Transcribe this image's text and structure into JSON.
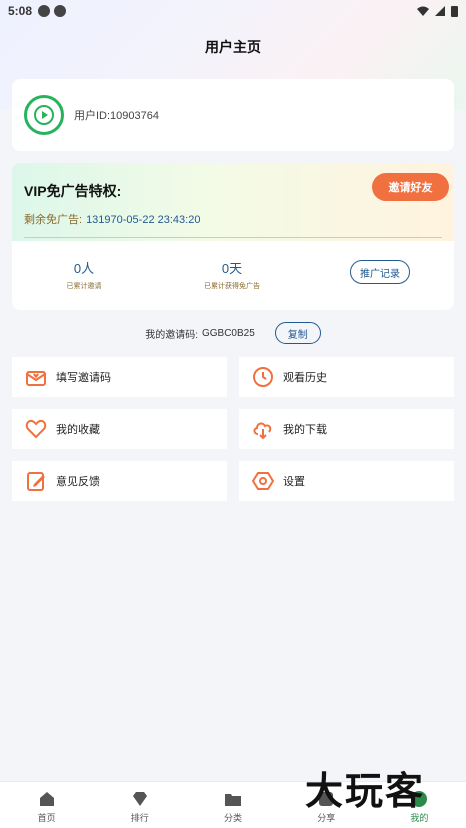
{
  "status_bar": {
    "time": "5:08"
  },
  "header": {
    "title": "用户主页"
  },
  "profile": {
    "user_id": "用户ID:10903764"
  },
  "vip": {
    "title": "VIP免广告特权:",
    "invite_button": "邀请好友",
    "remaining_label": "剩余免广告:",
    "remaining_value": "131970-05-22 23:43:20",
    "stats": [
      {
        "num": "0人",
        "label": "已累计邀请"
      },
      {
        "num": "0天",
        "label": "已累计获得免广告"
      }
    ],
    "record_button": "推广记录"
  },
  "invite_code": {
    "label": "我的邀请码:",
    "code": "GGBC0B25",
    "copy_button": "复制"
  },
  "menu": [
    {
      "label": "填写邀请码",
      "icon": "mail-heart-icon"
    },
    {
      "label": "观看历史",
      "icon": "clock-icon"
    },
    {
      "label": "我的收藏",
      "icon": "heart-icon"
    },
    {
      "label": "我的下载",
      "icon": "cloud-download-icon"
    },
    {
      "label": "意见反馈",
      "icon": "edit-icon"
    },
    {
      "label": "设置",
      "icon": "hexagon-gear-icon"
    }
  ],
  "tabs": [
    {
      "label": "首页",
      "icon": "home-icon"
    },
    {
      "label": "排行",
      "icon": "diamond-icon"
    },
    {
      "label": "分类",
      "icon": "folder-icon"
    },
    {
      "label": "分享",
      "icon": "share-icon"
    },
    {
      "label": "我的",
      "icon": "user-icon",
      "active": true
    }
  ],
  "watermark": "大玩客",
  "colors": {
    "accent": "#f1703f",
    "link": "#225a90",
    "active_tab": "#2a8a4a"
  }
}
